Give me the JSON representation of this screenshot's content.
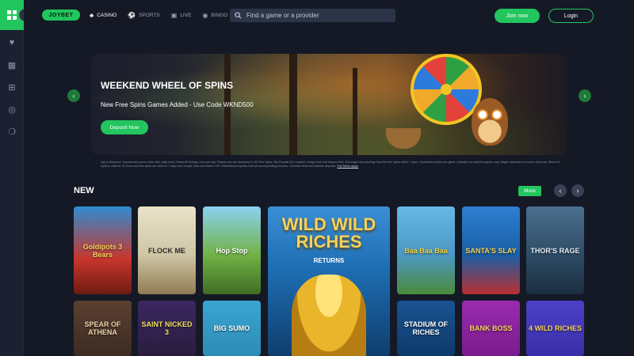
{
  "sidebar": {
    "toggle_icon": "chevron-right-icon",
    "items": [
      {
        "name": "grid-icon"
      },
      {
        "name": "heart-icon"
      },
      {
        "name": "slots-icon"
      },
      {
        "name": "gift-icon"
      },
      {
        "name": "chip-icon"
      },
      {
        "name": "chat-icon"
      }
    ]
  },
  "header": {
    "logo_text": "JOYBET",
    "nav": [
      {
        "label": "CASINO",
        "icon": "club-icon",
        "active": true
      },
      {
        "label": "SPORTS",
        "icon": "ball-icon",
        "active": false
      },
      {
        "label": "LIVE",
        "icon": "live-icon",
        "active": false
      },
      {
        "label": "BINGO",
        "icon": "bingo-icon",
        "active": false
      },
      {
        "label": "",
        "icon": "trophy-icon",
        "active": false
      }
    ],
    "search_placeholder": "Find a game or a provider",
    "join_label": "Join now",
    "login_label": "Login"
  },
  "banner": {
    "title": "WEEKEND WHEEL OF SPINS",
    "subtitle": "New Free Spins Games Added - Use Code WKND500",
    "cta_label": "Deposit Now",
    "prev_icon": "chevron-left-icon",
    "next_icon": "chevron-right-icon"
  },
  "terms": {
    "text": "Opt-in Required. Deposit with promo code offer, valid every Friday till Sunday, once per day. Players can win randomly 5-100 Free Spins. Min Deposit £20 required. Wager from real balance first. 50x wager any winnings from the free spins within 7 days. Contribution varies per game. Available on selected games only. Wager calculated on bonus bets only. Wheel of spins is valid for 24 hours and free spins are valid for 7 days from receipt. Max conversion: £20. Withdrawal requests void all active/pending bonuses. Excluded Skrill and Neteller deposits.",
    "link_label": "Full Terms apply."
  },
  "section": {
    "title": "NEW",
    "more_label": "More"
  },
  "games": [
    {
      "title": "Goldipots 3 Bears",
      "color": "#c8362c"
    },
    {
      "title": "FLOCK ME",
      "color": "#cfc6a6"
    },
    {
      "title": "Hop Stop",
      "color": "#72b347"
    },
    {
      "title": "WILD WILD RICHES",
      "subtitle": "RETURNS",
      "color": "#1f6fb4"
    },
    {
      "title": "Baa Baa Baa",
      "color": "#4c98c4"
    },
    {
      "title": "SANTA'S SLAY",
      "color": "#1b5fa6"
    },
    {
      "title": "THOR'S RAGE",
      "color": "#2d4c66"
    },
    {
      "title": "SPEAR OF ATHENA",
      "color": "#3d2b22"
    },
    {
      "title": "SAINT NICKED 3",
      "color": "#2a1c40"
    },
    {
      "title": "BIG SUMO",
      "color": "#2c8cb5"
    },
    {
      "title": "STADIUM OF RICHES",
      "color": "#0d3a6b"
    },
    {
      "title": "BANK BOSS",
      "color": "#7a1b8c"
    },
    {
      "title": "4 WILD RICHES",
      "color": "#3a2fa8"
    }
  ]
}
